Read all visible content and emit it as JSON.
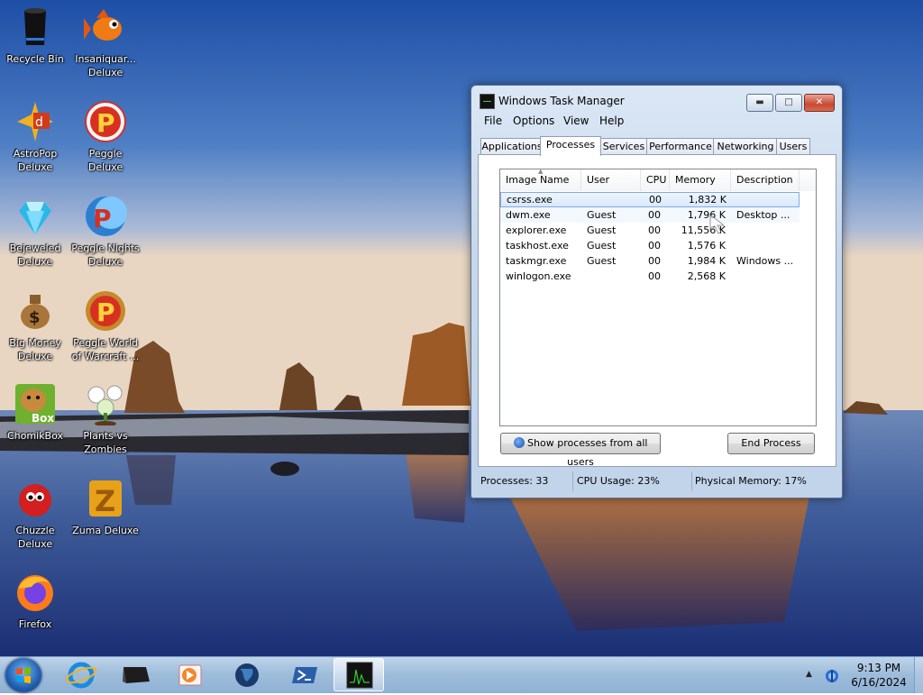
{
  "desktop": {
    "icons_col1": [
      {
        "label": "Recycle Bin",
        "icon": "recycle-bin-icon"
      },
      {
        "label": "AstroPop\nDeluxe",
        "icon": "astropop-icon"
      },
      {
        "label": "Bejeweled\nDeluxe",
        "icon": "bejeweled-icon"
      },
      {
        "label": "Big Money\nDeluxe",
        "icon": "money-bag-icon"
      },
      {
        "label": "ChomikBox",
        "icon": "chomikbox-icon"
      },
      {
        "label": "Chuzzle\nDeluxe",
        "icon": "chuzzle-icon"
      },
      {
        "label": "Firefox",
        "icon": "firefox-icon"
      }
    ],
    "icons_col2": [
      {
        "label": "Insaniquar...\nDeluxe",
        "icon": "fish-icon"
      },
      {
        "label": "Peggle Deluxe",
        "icon": "peggle-icon"
      },
      {
        "label": "Peggle Nights\nDeluxe",
        "icon": "peggle-nights-icon"
      },
      {
        "label": "Peggle World\nof Warcraft ...",
        "icon": "peggle-wow-icon"
      },
      {
        "label": "Plants vs\nZombies",
        "icon": "plants-vs-zombies-icon"
      },
      {
        "label": "Zuma Deluxe",
        "icon": "zuma-icon"
      }
    ]
  },
  "task_manager": {
    "title": "Windows Task Manager",
    "menu": [
      "File",
      "Options",
      "View",
      "Help"
    ],
    "tabs": [
      "Applications",
      "Processes",
      "Services",
      "Performance",
      "Networking",
      "Users"
    ],
    "active_tab": "Processes",
    "columns": [
      "Image Name",
      "User Name",
      "CPU",
      "Memory (...",
      "Description"
    ],
    "rows": [
      {
        "image": "csrss.exe",
        "user": "",
        "cpu": "00",
        "memory": "1,832 K",
        "desc": ""
      },
      {
        "image": "dwm.exe",
        "user": "Guest",
        "cpu": "00",
        "memory": "1,796 K",
        "desc": "Desktop ..."
      },
      {
        "image": "explorer.exe",
        "user": "Guest",
        "cpu": "00",
        "memory": "11,556 K",
        "desc": ""
      },
      {
        "image": "taskhost.exe",
        "user": "Guest",
        "cpu": "00",
        "memory": "1,576 K",
        "desc": ""
      },
      {
        "image": "taskmgr.exe",
        "user": "Guest",
        "cpu": "00",
        "memory": "1,984 K",
        "desc": "Windows ..."
      },
      {
        "image": "winlogon.exe",
        "user": "",
        "cpu": "00",
        "memory": "2,568 K",
        "desc": ""
      }
    ],
    "show_all_label": "Show processes from all users",
    "end_process_label": "End Process",
    "status": {
      "processes": "Processes: 33",
      "cpu": "CPU Usage: 23%",
      "memory": "Physical Memory: 17%"
    }
  },
  "taskbar": {
    "apps": [
      "internet-explorer-icon",
      "task-manager-icon",
      "media-player-icon",
      "globe-icon",
      "powershell-icon",
      "task-manager-active-icon"
    ],
    "time": "9:13 PM",
    "date": "6/16/2024"
  }
}
